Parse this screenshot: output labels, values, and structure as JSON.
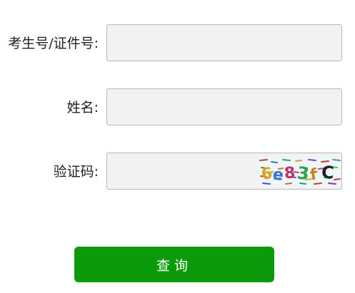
{
  "form": {
    "id_label": "考生号/证件号:",
    "id_value": "",
    "name_label": "姓名:",
    "name_value": "",
    "captcha_label": "验证码:",
    "captcha_value": "",
    "captcha_text": "6e83fc",
    "submit_label": "查询"
  },
  "colors": {
    "field_bg": "#f2f2f2",
    "field_border": "#b9b9b9",
    "button_bg": "#0a9a0a",
    "button_text": "#ffffff",
    "captcha_bg": "#eef7f6"
  }
}
